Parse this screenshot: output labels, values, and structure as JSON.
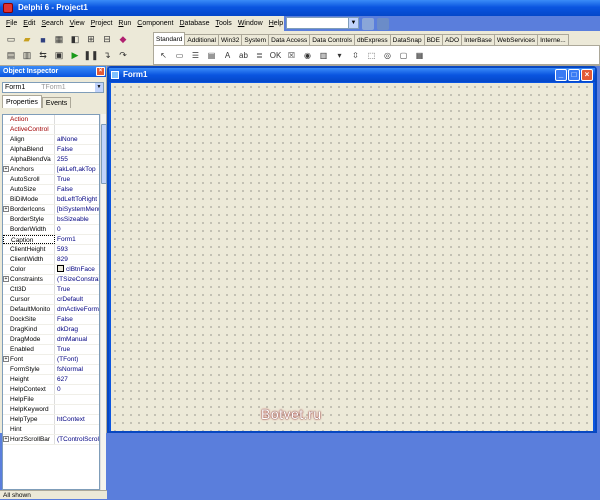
{
  "window": {
    "title": "Delphi 6 - Project1"
  },
  "menu": [
    "File",
    "Edit",
    "Search",
    "View",
    "Project",
    "Run",
    "Component",
    "Database",
    "Tools",
    "Window",
    "Help"
  ],
  "desktop_combo": {
    "value": "",
    "arrow": "▼"
  },
  "toolbar_icons": [
    "new-icon",
    "open-icon",
    "save-icon",
    "save-all-icon",
    "open-project-icon",
    "add-file-icon",
    "remove-file-icon",
    "help-icon",
    "view-unit-icon",
    "view-form-icon",
    "toggle-icon",
    "new-form-icon",
    "run-icon",
    "pause-icon",
    "trace-into-icon",
    "step-over-icon"
  ],
  "palette_tabs": [
    "Standard",
    "Additional",
    "Win32",
    "System",
    "Data Access",
    "Data Controls",
    "dbExpress",
    "DataSnap",
    "BDE",
    "ADO",
    "InterBase",
    "WebServices",
    "Interne..."
  ],
  "palette_active_tab": "Standard",
  "palette_components": [
    "pointer",
    "frames",
    "mainmenu",
    "popupmenu",
    "label",
    "edit",
    "memo",
    "button",
    "checkbox",
    "radiobutton",
    "listbox",
    "combobox",
    "scrollbar",
    "groupbox",
    "radiogroup",
    "panel",
    "actionlist"
  ],
  "inspector": {
    "title": "Object Inspector",
    "object": "Form1",
    "object_type": "TForm1",
    "tabs": [
      "Properties",
      "Events"
    ],
    "active_tab": "Properties",
    "rows": [
      {
        "k": "Action",
        "v": "",
        "red": true
      },
      {
        "k": "ActiveControl",
        "v": "",
        "red": true
      },
      {
        "k": "Align",
        "v": "alNone"
      },
      {
        "k": "AlphaBlend",
        "v": "False"
      },
      {
        "k": "AlphaBlendVa",
        "v": "255"
      },
      {
        "k": "Anchors",
        "v": "[akLeft,akTop",
        "plus": true
      },
      {
        "k": "AutoScroll",
        "v": "True"
      },
      {
        "k": "AutoSize",
        "v": "False"
      },
      {
        "k": "BiDiMode",
        "v": "bdLeftToRight"
      },
      {
        "k": "BorderIcons",
        "v": "[biSystemMenu",
        "plus": true
      },
      {
        "k": "BorderStyle",
        "v": "bsSizeable"
      },
      {
        "k": "BorderWidth",
        "v": "0"
      },
      {
        "k": "Caption",
        "v": "Form1",
        "sel": true
      },
      {
        "k": "ClientHeight",
        "v": "593"
      },
      {
        "k": "ClientWidth",
        "v": "829"
      },
      {
        "k": "Color",
        "v": "clBtnFace",
        "swatch": true
      },
      {
        "k": "Constraints",
        "v": "(TSizeConstrai",
        "plus": true
      },
      {
        "k": "Ctl3D",
        "v": "True"
      },
      {
        "k": "Cursor",
        "v": "crDefault"
      },
      {
        "k": "DefaultMonito",
        "v": "dmActiveForm"
      },
      {
        "k": "DockSite",
        "v": "False"
      },
      {
        "k": "DragKind",
        "v": "dkDrag"
      },
      {
        "k": "DragMode",
        "v": "dmManual"
      },
      {
        "k": "Enabled",
        "v": "True"
      },
      {
        "k": "Font",
        "v": "(TFont)",
        "plus": true
      },
      {
        "k": "FormStyle",
        "v": "fsNormal"
      },
      {
        "k": "Height",
        "v": "627"
      },
      {
        "k": "HelpContext",
        "v": "0"
      },
      {
        "k": "HelpFile",
        "v": ""
      },
      {
        "k": "HelpKeyword",
        "v": ""
      },
      {
        "k": "HelpType",
        "v": "htContext"
      },
      {
        "k": "Hint",
        "v": ""
      },
      {
        "k": "HorzScrollBar",
        "v": "(TControlScroll",
        "plus": true
      }
    ],
    "status": "All shown"
  },
  "form": {
    "title": "Form1"
  },
  "watermark": "Botvet.ru"
}
